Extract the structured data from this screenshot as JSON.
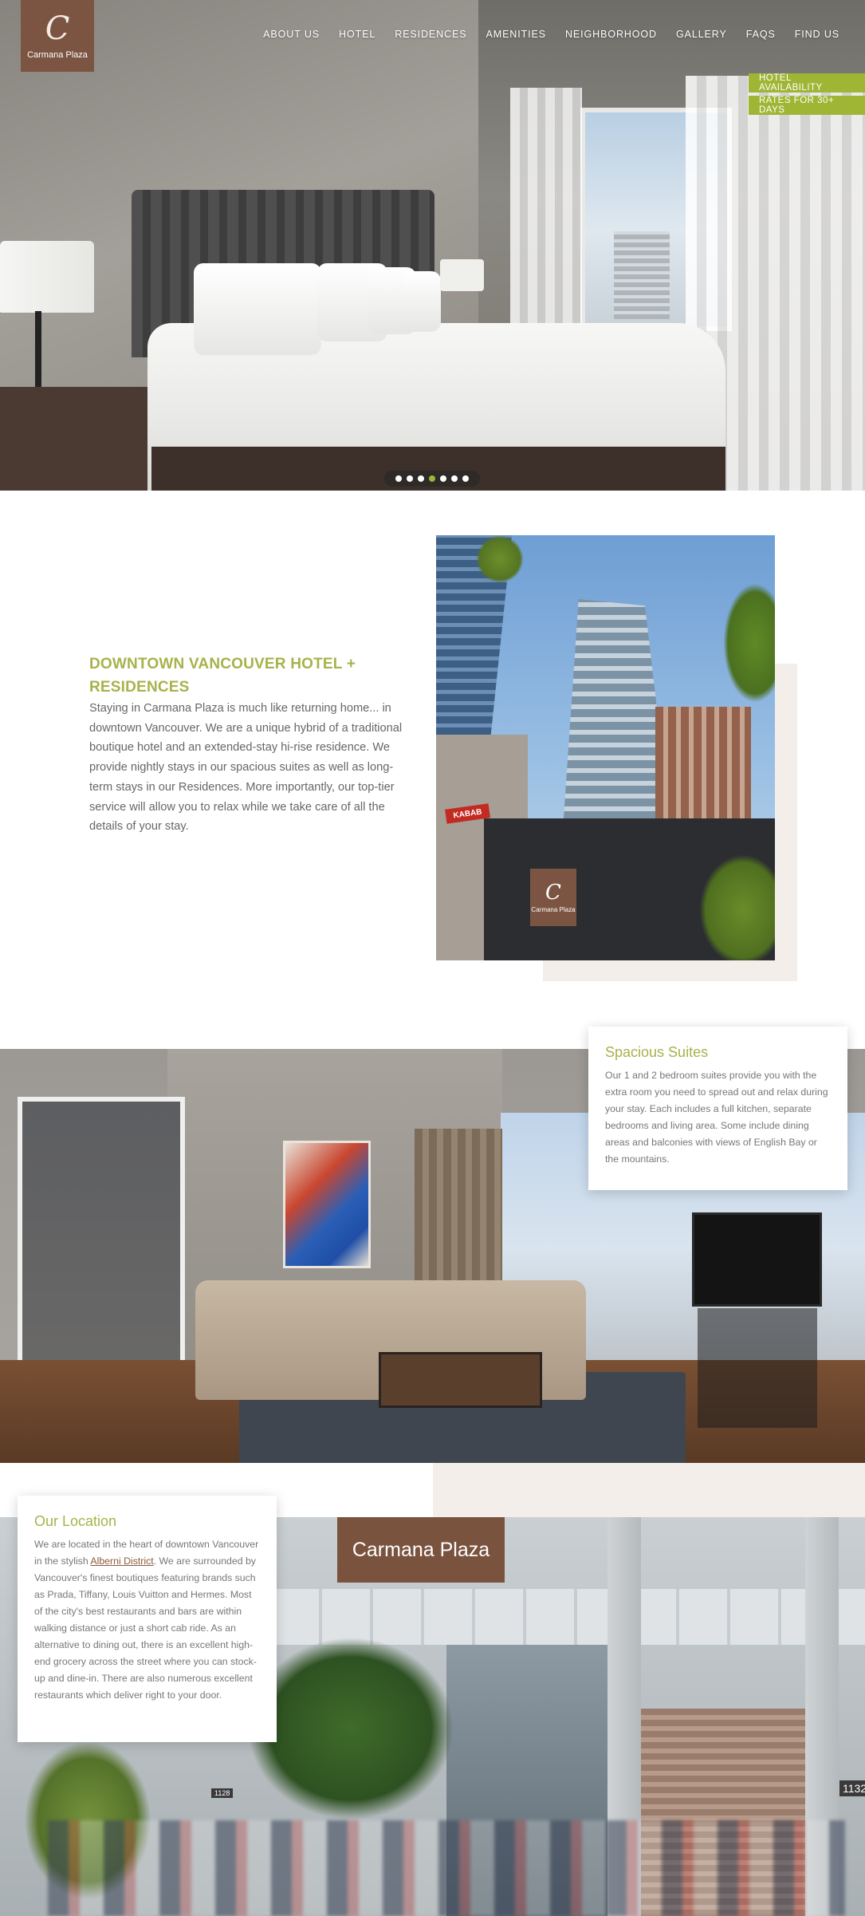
{
  "brand": {
    "logo_mark": "C",
    "logo_text": "Carmana Plaza"
  },
  "nav": [
    {
      "label": "ABOUT US"
    },
    {
      "label": "HOTEL"
    },
    {
      "label": "RESIDENCES"
    },
    {
      "label": "AMENITIES"
    },
    {
      "label": "NEIGHBORHOOD"
    },
    {
      "label": "GALLERY"
    },
    {
      "label": "FAQS"
    },
    {
      "label": "FIND US"
    }
  ],
  "cta": {
    "availability": "HOTEL AVAILABILITY",
    "rates": "RATES FOR 30+ DAYS"
  },
  "slider": {
    "count": 7,
    "active_index": 3,
    "accent": "#9fb534"
  },
  "intro": {
    "title": "DOWNTOWN VANCOUVER HOTEL + RESIDENCES",
    "body": "Staying in Carmana Plaza is much like returning home... in downtown Vancouver. We are a unique hybrid of a traditional boutique hotel and an extended-stay hi-rise residence. We provide nightly stays in our spacious suites as well as long-term stays in our Residences. More importantly, our top-tier service will allow you to relax while we take care of all the details of your stay.",
    "photo_sign_mark": "C",
    "photo_sign_text": "Carmana Plaza",
    "photo_restaurant_sign": "KABAB"
  },
  "suites": {
    "title": "Spacious Suites",
    "body": "Our 1 and 2 bedroom suites provide you with the extra room you need to spread out and relax during your stay. Each includes a full kitchen, separate bedrooms and living area. Some include dining areas and balconies with views of English Bay or the mountains."
  },
  "location": {
    "title": "Our Location",
    "body_before": "We are located in the heart of downtown Vancouver in the stylish ",
    "link": "Alberni District",
    "body_after": ". We are surrounded by Vancouver's finest boutiques featuring brands such as Prada, Tiffany, Louis Vuitton and Hermes. Most of the city's best restaurants and bars are within walking distance or just a short cab ride. As an alternative to dining out, there is an excellent high-end grocery across the street where you can stock-up and dine-in. There are also numerous excellent restaurants which deliver right to your door.",
    "photo_sign": "Carmana Plaza",
    "street_number_1": "1128",
    "street_number_2": "1132"
  },
  "colors": {
    "accent_green": "#a8b24a",
    "brand_brown": "#7c5542",
    "beige": "#f3eeea"
  }
}
